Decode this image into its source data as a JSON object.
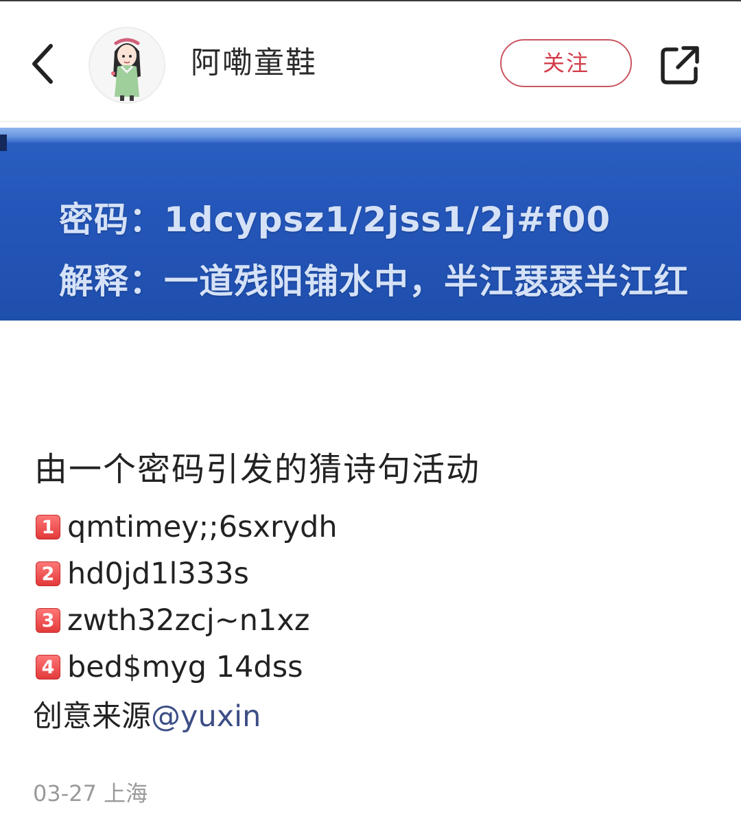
{
  "header": {
    "back_icon": "chevron-left-icon",
    "avatar_icon": "avatar-girl-illustration",
    "username": "阿嘞童鞋",
    "follow_label": "关注",
    "share_icon": "share-icon",
    "follow_color": "#d23c48"
  },
  "banner": {
    "line1": "密码：1dcypsz1/2jss1/2j#f00",
    "line2": "解释：一道残阳铺水中，半江瑟瑟半江红",
    "bg_color": "#2456b9",
    "text_color": "#d4e1f7"
  },
  "post": {
    "title": "由一个密码引发的猜诗句活动",
    "items": [
      {
        "badge": "1",
        "text": "qmtimey;;6sxrydh"
      },
      {
        "badge": "2",
        "text": "hd0jd1l333s"
      },
      {
        "badge": "3",
        "text": "zwth32zcj~n1xz"
      },
      {
        "badge": "4",
        "text": "bed$myg 14dss"
      }
    ],
    "credit_prefix": "创意来源",
    "credit_mention": "@yuxin",
    "date": "03-27",
    "location": "上海"
  }
}
